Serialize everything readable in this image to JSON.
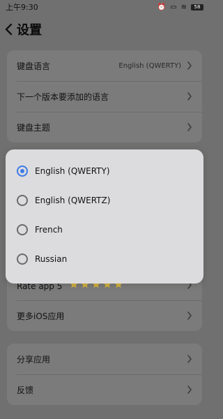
{
  "status_bar": {
    "time": "上午9:30",
    "icons": [
      "alarm-off-icon",
      "screen-off-icon",
      "wifi-icon",
      "battery-icon"
    ],
    "battery_label": "58"
  },
  "header": {
    "title": "设置",
    "back_icon": "chevron-left-icon"
  },
  "settings": {
    "section1": [
      {
        "label": "键盘语言",
        "value": "English (QWERTY)"
      },
      {
        "label": "下一个版本要添加的语言",
        "value": ""
      },
      {
        "label": "键盘主题",
        "value": ""
      }
    ],
    "section2": [
      {
        "label": "Rate app 5",
        "stars": 5
      },
      {
        "label": "更多iOS应用"
      }
    ],
    "section3": [
      {
        "label": "分享应用"
      },
      {
        "label": "反馈"
      }
    ]
  },
  "dialog": {
    "options": [
      {
        "label": "English (QWERTY)",
        "selected": true
      },
      {
        "label": "English (QWERTZ)",
        "selected": false
      },
      {
        "label": "French",
        "selected": false
      },
      {
        "label": "Russian",
        "selected": false
      }
    ]
  },
  "colors": {
    "accent": "#3f7ae6",
    "modal_bg": "#dcdcdf",
    "dim_bg": "#707070",
    "star": "#d4b23d"
  }
}
